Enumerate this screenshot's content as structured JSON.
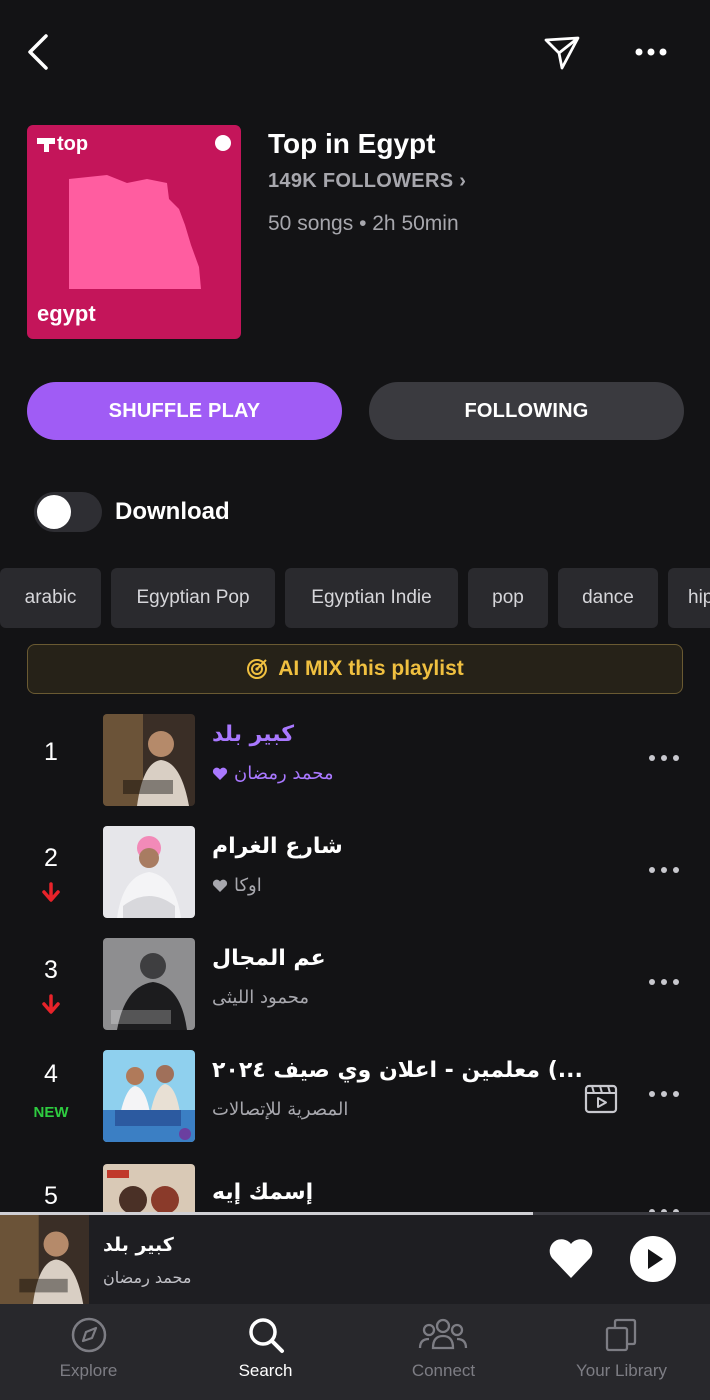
{
  "playlist": {
    "cover_brand": "top",
    "cover_country": "egypt",
    "title": "Top in Egypt",
    "followers": "149K FOLLOWERS ›",
    "meta": "50 songs • 2h 50min",
    "cover_color": "#c4155a"
  },
  "actions": {
    "shuffle_label": "SHUFFLE PLAY",
    "following_label": "FOLLOWING",
    "download_label": "Download",
    "download_enabled": false,
    "accent_color": "#a05cf5"
  },
  "chips": [
    "arabic",
    "Egyptian Pop",
    "Egyptian Indie",
    "pop",
    "dance",
    "hip"
  ],
  "ai_mix": {
    "label": "AI MIX this playlist",
    "icon": "target-icon"
  },
  "tracks": [
    {
      "rank": "1",
      "title": "كبير بلد",
      "artist": "محمد رمضان",
      "liked": true,
      "trend": "",
      "badge": ""
    },
    {
      "rank": "2",
      "title": "شارع الغرام",
      "artist": "اوكا",
      "liked": true,
      "trend": "down",
      "badge": ""
    },
    {
      "rank": "3",
      "title": "عم المجال",
      "artist": "محمود الليثى",
      "liked": false,
      "trend": "down",
      "badge": ""
    },
    {
      "rank": "4",
      "title": "معلمين - اعلان وي صيف ٢٠٢٤ (...",
      "artist": "المصرية للإتصالات",
      "liked": false,
      "trend": "",
      "badge": "NEW",
      "has_video": true
    },
    {
      "rank": "5",
      "title": "إسمك إيه",
      "artist": "",
      "liked": false,
      "trend": "",
      "badge": ""
    }
  ],
  "now_playing": {
    "title": "كبير بلد",
    "artist": "محمد رمضان",
    "progress": 0.75
  },
  "nav": {
    "explore": "Explore",
    "search": "Search",
    "connect": "Connect",
    "library": "Your Library",
    "selected": "search"
  }
}
